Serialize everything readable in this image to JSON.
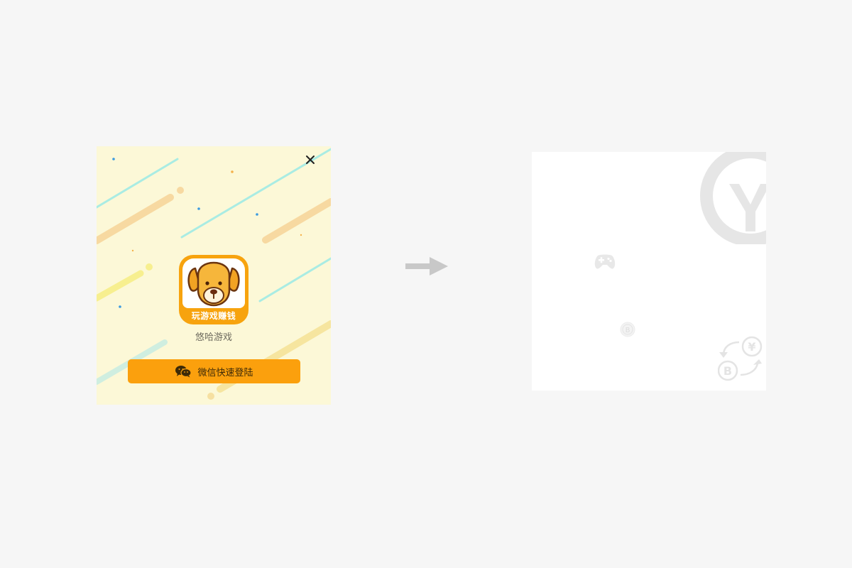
{
  "login_card": {
    "app_icon_banner": "玩游戏赚钱",
    "app_name": "悠哈游戏",
    "login_button_label": "微信快速登陆",
    "close_icon": "close-icon",
    "colors": {
      "background": "#fcf8d7",
      "accent": "#fba00d",
      "icon_orange": "#f7a30e"
    }
  },
  "transition": {
    "arrow_icon": "arrow-right-icon"
  },
  "blank_screen": {
    "logo_letter": "Y",
    "icons": [
      "gamepad-icon",
      "bitcoin-coin-icon",
      "currency-exchange-icon"
    ]
  }
}
